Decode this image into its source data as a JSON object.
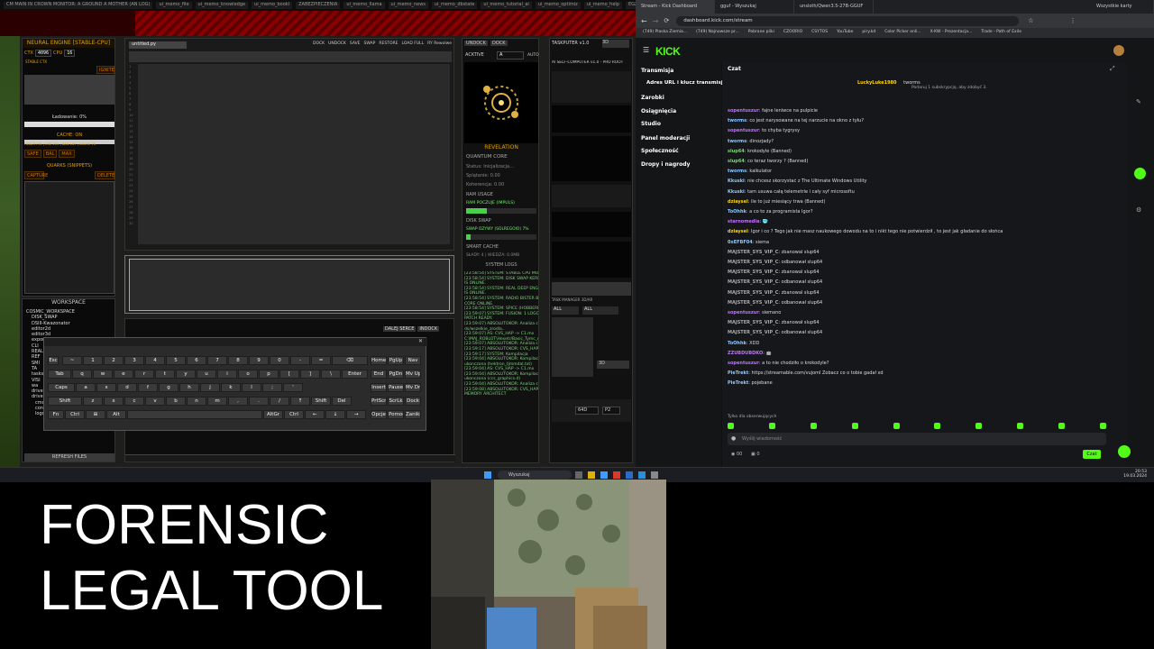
{
  "os_taskbar": {
    "search_placeholder": "Wyszukaj",
    "time": "20:53",
    "date": "19.03.2024"
  },
  "left_app": {
    "top_tabs": [
      "CM MAIN IN CROWN MONITOR: A GROUND A MOTHER (AN LOG)",
      "ui_memo_file",
      "ui_memo_knowledge",
      "ui_memo_bookl",
      "ZABEZPIECZENIA",
      "ui_memo_llama",
      "ui_memo_news",
      "ui_memo_dbstate",
      "ui_memo_tutorial_ai",
      "ui_memo_optimiz",
      "ui_memo_help",
      "EGZEI",
      "ui_memo_theme"
    ],
    "neural_engine": {
      "title": "NEURAL ENGINE [STABLE-CPU]",
      "ctx_label": "CTX",
      "ctx_value": "4096",
      "cpu_label": "CPU",
      "cpu_value": "16",
      "stable_label": "STABLE CTX",
      "ignite_button": "IGNITE",
      "loading_label": "Ładowanie: 0%",
      "cache_label": "CACHE: ON",
      "health_line": "HEALTH 96 | CRE 209 | BAN 169 | CACHE 76",
      "safe": "SAFE",
      "bal": "BAL",
      "max": "MAX",
      "quarks_title": "QUARKS (SNIPPETS)",
      "capture": "CAPTURE",
      "delete": "DELETE"
    },
    "workspace": {
      "title": "WORKSPACE",
      "items": [
        "COSMIC_WORKSPACE",
        "DISK_SWAP",
        "DSIII-Kwazonator",
        "editor2d",
        "editor3d",
        "exports",
        "CLI",
        "REAL",
        "REF",
        "SMI",
        "TA",
        "tasks",
        "VISI",
        "wa",
        "drive",
        "drive2",
        "cmd.exe",
        "context_swap.dat",
        "logo.png"
      ],
      "refresh": "REFRESH FILES"
    },
    "editor": {
      "filename": "untitled.py",
      "menu": [
        "DOCK",
        "UNDOCK",
        "SAVE",
        "SWAP",
        "RESTORE",
        "LOAD FULL",
        "RY Rewolwe"
      ]
    },
    "bottom_bar": {
      "tabs": [
        "DALEJ SERCE",
        "INDOCK"
      ]
    },
    "revelation": {
      "tab1": "UNDOCK",
      "tab2": "DOCK",
      "activate": "ACKTIVE",
      "field": "A",
      "auto": "AUTO",
      "title": "REVELATION",
      "quantum_core": "QUANTUM CORE",
      "status": "Status: Inicjalizacja...",
      "splatanie": "Splątanie: 0.00",
      "koherencja": "Koherencja: 0.00",
      "ram_usage": "RAM USAGE",
      "ram_pool": "RAM POCZUJE (IMPULS)",
      "disk_swap": "DISK SWAP",
      "swap_line": "SWAP OZYWY (SOLREGOIO) 7%",
      "smart_cache": "SMART CACHE",
      "smart_line": "SŁADY: 4 | WIEDZA: 0.0MB",
      "system_logs": "SYSTEM LOGS"
    },
    "logs": [
      "[23:58:54] SYSTEM: STABLE CPU MODE ACTIVE",
      "[23:58:54] SYSTEM: DISK SWAP KERNEL",
      "IS ONLINE.",
      "[23:58:54] SYSTEM: REAL DEEP ENGINE",
      "IS ONLINE.",
      "[23:58:54] SYSTEM: RADIO BISTER BEZ",
      "CORE ONLINE.",
      "[23:58:54] SYSTEM: SPICE (HOBBERHEAD)",
      "[23:59:07] SYSTEM: FUSION: 1 LOGO FOR",
      "PATCH READY.",
      "[23:59:07] ABSOLUTOKOR: Analiza cubh",
      "ds/wszelkie_zrodla..",
      "[23:59:07] AS: CVS_HAP -> C1.mx",
      "C:\\MAJ_ROBLOT\\Hesetr/Basic_Tymc_me",
      "[23:59:07] ABSOLUTOKOR: Analiza cubh",
      "[23:59:17] ABSOLUTOKOR: CVS_HAP -> C",
      "[23:59:17] SYSTEM: Kompilacja",
      "[23:59:04] ABSOLUTOKOR: Kompilacja",
      "ukonczona (hektron_tjmmdal.txt)",
      "[23:59:04] AS: CVS_HAP -> C1.mx",
      "[23:59:04] ABSOLUTOKOR: Kompilacja",
      "ukonczona (ccs_graphics.d)",
      "[23:59:04] ABSOLUTOKOR: Analiza cubh",
      "[23:59:08] ABSOLUTOKOR: CVS_HAP",
      "MEMORY ARCHITECT"
    ],
    "taskputer": {
      "title": "TASKPUTER v1.0",
      "ai_line": "AI SELF-COMPUTER v1.0 - PRO ROOT",
      "dropdown1": "ALL",
      "dropdown2": "ALL",
      "value3d": "3D",
      "task_manager": "TASK MANAGER 3D/AR",
      "field64": "64D",
      "fieldP2": "P2"
    }
  },
  "browser": {
    "tabs": [
      "Stream - Kick Dashboard",
      "gguf - Wyszukaj",
      "unsloth/Qwen3.5-27B-GGUF",
      "Wszystkie karty"
    ],
    "url": "dashboard.kick.com/stream",
    "bookmarks": [
      "(749) Plaska Ziemia...",
      "(749) Najnowsze pr...",
      "Pobrane pliki",
      "CZOORIO",
      "CSYTOS",
      "YouTube",
      "piry.kd",
      "Color Picker onli...",
      "X-KW - Prezentacja...",
      "Trade - Path of Exile"
    ],
    "logo": "KICK",
    "sidebar": [
      "Transmisja",
      "Adres URL i klucz transmisji",
      "Zarobki",
      "Osiągnięcia",
      "Studio",
      "Panel moderacji",
      "Społeczność",
      "Dropy i nagrody"
    ],
    "chat_title": "Czat",
    "pinned": {
      "user": "LuckyLuke1980",
      "text": "tworms",
      "sub": "Podaruj 1 subskrypcję, aby zdobyć 3."
    },
    "messages": [
      {
        "user": "sopentuszur",
        "color": "#c070ff",
        "text": "fajne leniwce na pulpicie"
      },
      {
        "user": "tworms",
        "color": "#8cc8ff",
        "text": "co jest narysowane na tej narzucie na okno z tyłu?"
      },
      {
        "user": "sopentuszur",
        "color": "#c070ff",
        "text": "to chyba tygrysy"
      },
      {
        "user": "tworms",
        "color": "#8cc8ff",
        "text": "dinozjady?"
      },
      {
        "user": "slup64",
        "color": "#7fd07f",
        "text": "krokodyle (Banned)"
      },
      {
        "user": "slup64",
        "color": "#7fd07f",
        "text": "co teraz tworzy ? (Banned)"
      },
      {
        "user": "tworms",
        "color": "#8cc8ff",
        "text": "kalkulator"
      },
      {
        "user": "Kkuski",
        "color": "#8cc8ff",
        "text": "nie chcesz skorzystać z The Ultimate Windows Utility"
      },
      {
        "user": "Kkuski",
        "color": "#8cc8ff",
        "text": "tam usuwa całą telemetrie i cały syf microsoftu"
      },
      {
        "user": "dziaysel",
        "color": "#ffd400",
        "text": "ile to już miesiący trwa (Banned)"
      },
      {
        "user": "ToOhhk",
        "color": "#8cc8ff",
        "text": "a co to za programista Igor?"
      },
      {
        "user": "starnomedia",
        "color": "#c070ff",
        "text": "🥶"
      },
      {
        "user": "dziaysel",
        "color": "#ffd400",
        "text": "Igor i co ? Tego jak nie masz naukowego dowodu na to i nikt tego nie potwierdził , to jest jak gładanie do słońca"
      },
      {
        "user": "0xEFBF04",
        "color": "#8cc8ff",
        "text": "siema"
      },
      {
        "user": "MAJSTER_SYS_VIP_C",
        "color": "#aaaaaa",
        "text": "zbanowal slup64"
      },
      {
        "user": "MAJSTER_SYS_VIP_C",
        "color": "#aaaaaa",
        "text": "odbanował slup64"
      },
      {
        "user": "MAJSTER_SYS_VIP_C",
        "color": "#aaaaaa",
        "text": "zbanowal slup64"
      },
      {
        "user": "MAJSTER_SYS_VIP_C",
        "color": "#aaaaaa",
        "text": "odbanował slup64"
      },
      {
        "user": "MAJSTER_SYS_VIP_C",
        "color": "#aaaaaa",
        "text": "zbanowal slup64"
      },
      {
        "user": "MAJSTER_SYS_VIP_C",
        "color": "#aaaaaa",
        "text": "odbanował slup64"
      },
      {
        "user": "sopentuszur",
        "color": "#c070ff",
        "text": "siemano"
      },
      {
        "user": "MAJSTER_SYS_VIP_C",
        "color": "#aaaaaa",
        "text": "zbanował slup64"
      },
      {
        "user": "MAJSTER_SYS_VIP_C",
        "color": "#aaaaaa",
        "text": "odbanował slup64"
      },
      {
        "user": "ToOhhk",
        "color": "#8cc8ff",
        "text": "XDD"
      },
      {
        "user": "ZZUBDUBDKO",
        "color": "#c070ff",
        "text": "🤖"
      },
      {
        "user": "sopentuszur",
        "color": "#c070ff",
        "text": "a to nie chodziło o krokodyle?"
      },
      {
        "user": "PieTrekt",
        "color": "#8cc8ff",
        "text": "https://streamable.com/vujoml Zobacz co o tobie gadał xd"
      },
      {
        "user": "PieTrekt",
        "color": "#8cc8ff",
        "text": "pojebane"
      }
    ],
    "followers_mode": "Tylko dla obserwujących",
    "chat_placeholder": "Wyślij wiadomość",
    "viewers": "00",
    "gift_count": "0",
    "chat_button": "Czat"
  },
  "overlay": {
    "line1": "FORENSIC",
    "line2": "LEGAL TOOL"
  }
}
